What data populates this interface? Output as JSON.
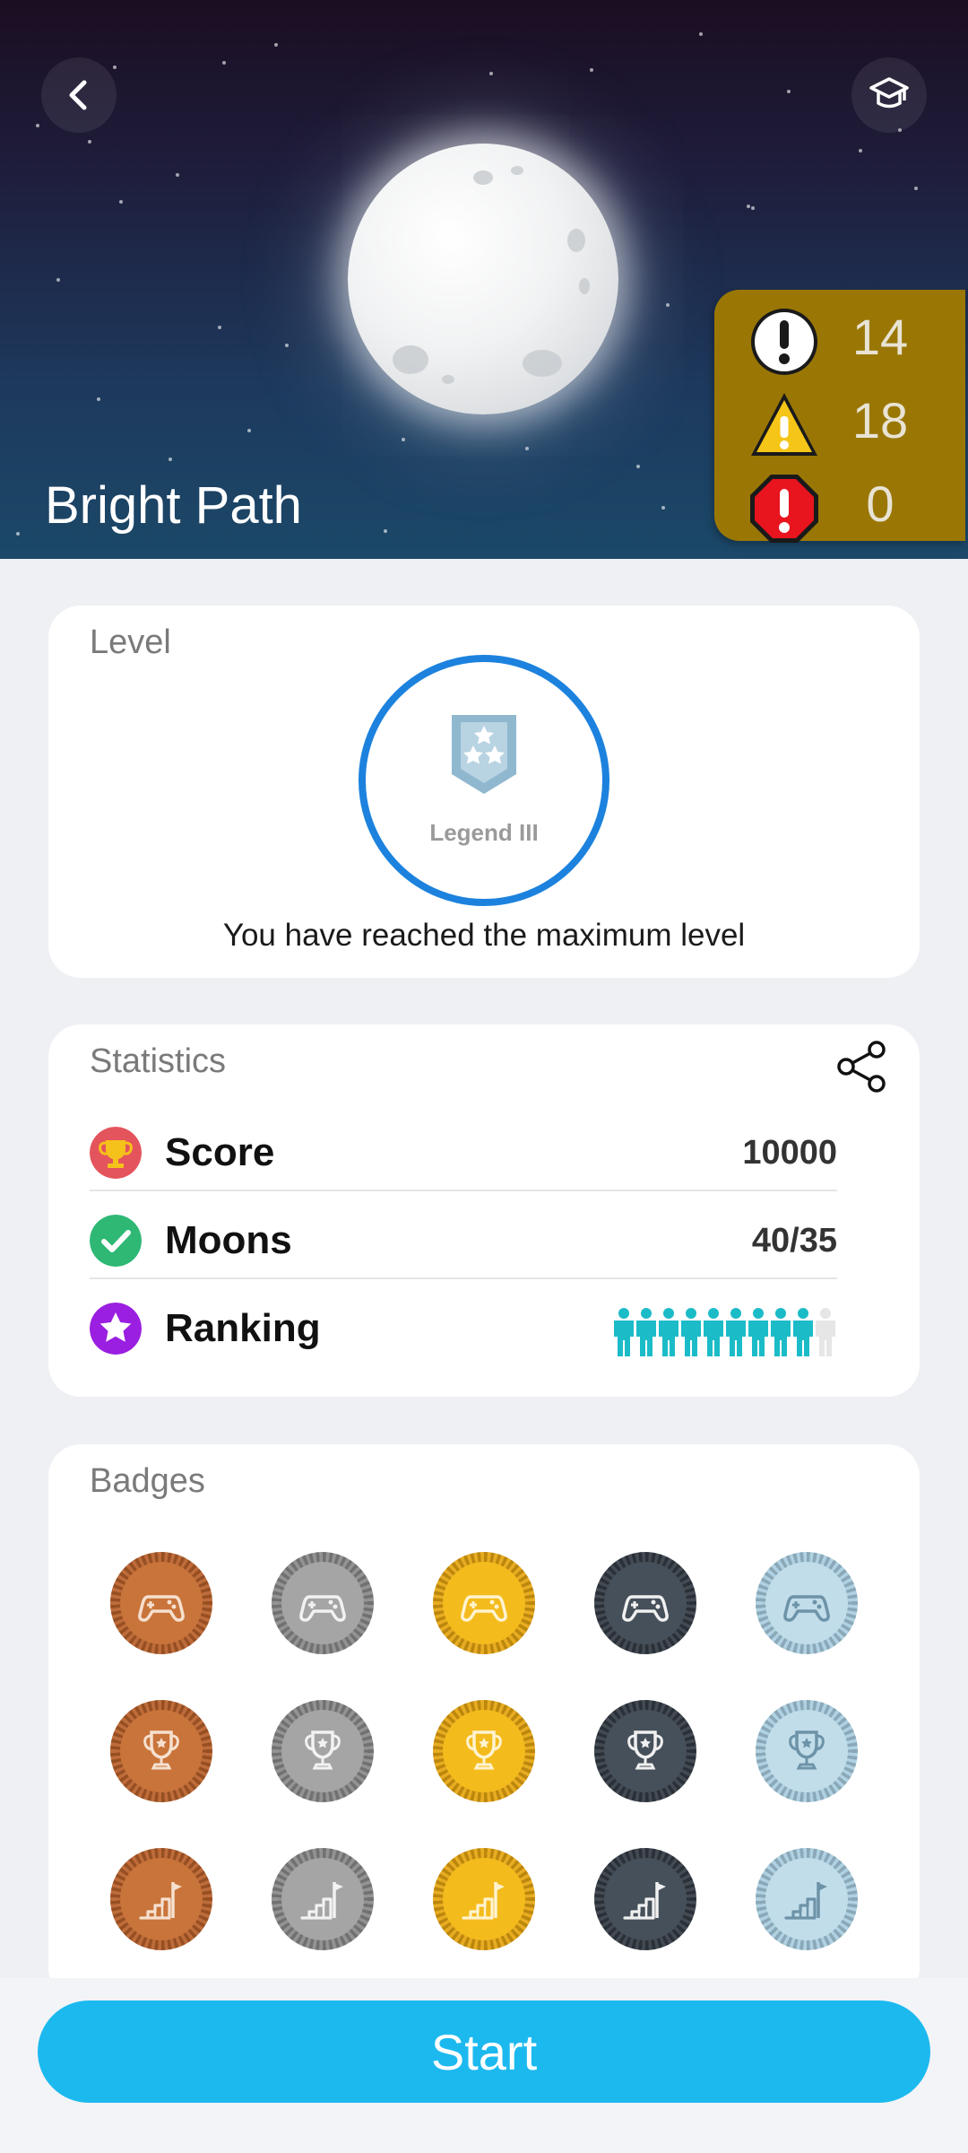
{
  "header": {
    "title": "Bright Path",
    "back_icon": "chevron-left-icon",
    "graduation_icon": "graduation-cap-icon",
    "alerts": [
      {
        "icon": "exclamation-circle-icon",
        "count": "14"
      },
      {
        "icon": "warning-triangle-icon",
        "count": "18"
      },
      {
        "icon": "error-octagon-icon",
        "count": "0"
      }
    ]
  },
  "level": {
    "title": "Level",
    "badge_name": "Legend III",
    "message": "You have reached the maximum level"
  },
  "statistics": {
    "title": "Statistics",
    "rows": [
      {
        "label": "Score",
        "value": "10000",
        "icon": "trophy-icon",
        "color": "#e4545c"
      },
      {
        "label": "Moons",
        "value": "40/35",
        "icon": "check-circle-icon",
        "color": "#2eb874"
      },
      {
        "label": "Ranking",
        "icon": "star-circle-icon",
        "color": "#9a1fe0",
        "rank_filled_of_10": 9
      }
    ]
  },
  "badges": {
    "title": "Badges",
    "rows": [
      "gamepad",
      "trophy",
      "stairs-flag"
    ],
    "tiers": [
      "bronze",
      "silver",
      "gold",
      "dark",
      "ice"
    ]
  },
  "footer": {
    "start_label": "Start"
  },
  "colors": {
    "accent": "#1cb9ef",
    "ring": "#1c82de",
    "alerts_bg": "#9a7705",
    "ranking": "#1bbcc8"
  }
}
